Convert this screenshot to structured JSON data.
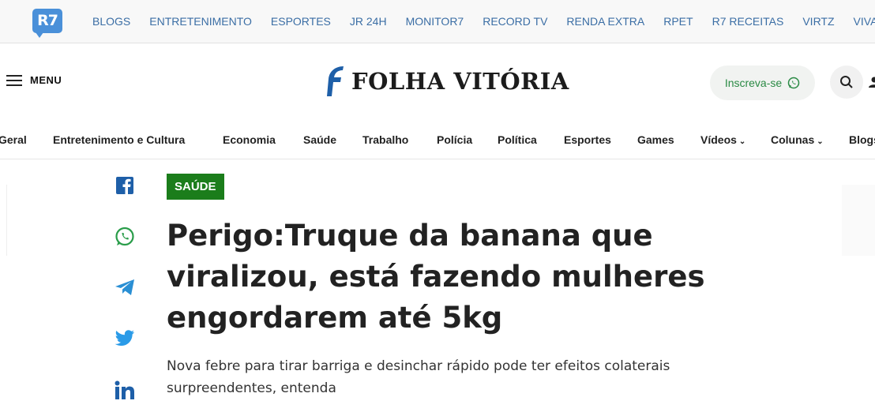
{
  "topbar": {
    "logo_text": "R7",
    "links": [
      "BLOGS",
      "ENTRETENIMENTO",
      "ESPORTES",
      "JR 24H",
      "MONITOR7",
      "RECORD TV",
      "RENDA EXTRA",
      "RPET",
      "R7 RECEITAS",
      "VIRTZ",
      "VIVA A VIDA"
    ]
  },
  "header": {
    "menu_label": "MENU",
    "logo_text": "FOLHA VITÓRIA",
    "subscribe_label": "Inscreva-se",
    "icons": [
      "menu-icon",
      "whatsapp-icon",
      "search-icon",
      "user-icon"
    ]
  },
  "nav": {
    "items": [
      "Geral",
      "Entretenimento e Cultura",
      "Economia",
      "Saúde",
      "Trabalho",
      "Polícia",
      "Política",
      "Esportes",
      "Games",
      "Vídeos",
      "Colunas",
      "Blogs"
    ]
  },
  "article": {
    "tag": "SAÚDE",
    "title": "Perigo:Truque da banana que viralizou, está fazendo mulheres engordarem até 5kg",
    "subtitle": "Nova febre para tirar barriga e desinchar rápido pode ter efeitos colaterais surpreendentes, entenda",
    "share_icons": [
      "facebook-icon",
      "whatsapp-icon",
      "telegram-icon",
      "twitter-icon",
      "linkedin-icon"
    ]
  },
  "colors": {
    "accent_green": "#1b7d1b",
    "link_blue": "#3b6ea5",
    "brand_blue": "#1e5fa8"
  }
}
